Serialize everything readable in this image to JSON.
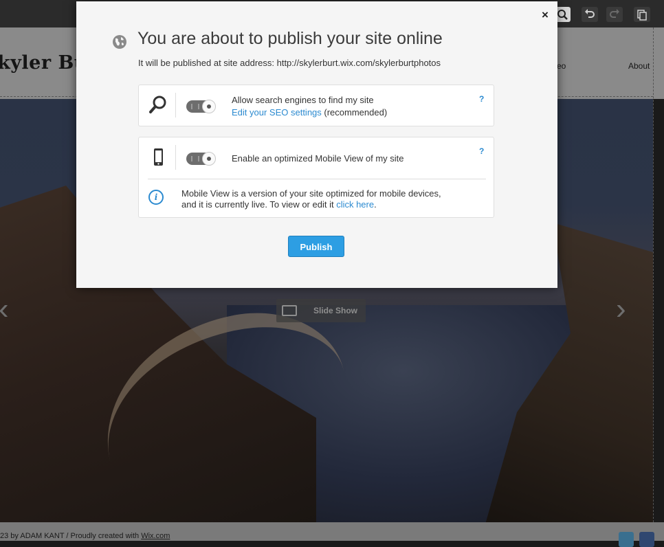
{
  "editor_toolbar": {
    "icons": [
      "zoom-icon",
      "undo-icon",
      "redo-icon",
      "duplicate-icon"
    ]
  },
  "site": {
    "logo_text": "kyler Burt",
    "nav": [
      "eo",
      "About"
    ],
    "slideshow_label": "Slide Show",
    "footer_prefix": "23 by ADAM KANT / Proudly created with ",
    "footer_link": "Wix.com"
  },
  "modal": {
    "title": "You are about to publish your site online",
    "subtitle": "It will be published at site address: http://skylerburt.wix.com/skylerburtphotos",
    "close_label": "×",
    "search_panel": {
      "line1": "Allow search engines to find my site",
      "link": "Edit your SEO settings",
      "suffix": " (recommended)",
      "help": "?",
      "toggle_on": true
    },
    "mobile_panel": {
      "line1": "Enable an optimized Mobile View of my site",
      "help": "?",
      "toggle_on": true,
      "info_text": "Mobile View is a version of your site optimized for mobile devices, and it is currently live. To view or edit it ",
      "info_link": "click here",
      "info_end": "."
    },
    "publish_label": "Publish"
  },
  "colors": {
    "accent": "#2d9ee3",
    "link": "#2b8ad0"
  }
}
